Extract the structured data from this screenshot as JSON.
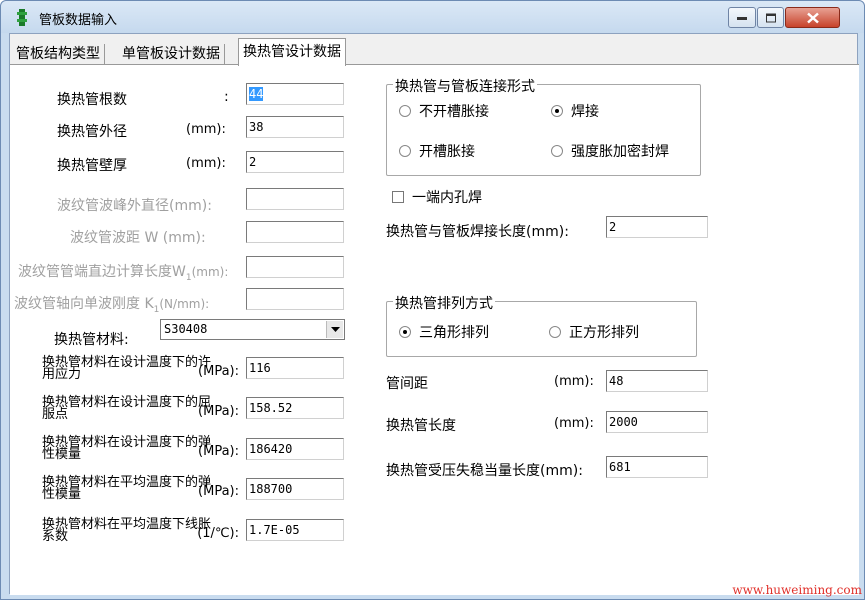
{
  "window": {
    "title": "管板数据输入"
  },
  "tabs": [
    {
      "label": "管板结构类型"
    },
    {
      "label": "单管板设计数据"
    },
    {
      "label": "换热管设计数据"
    }
  ],
  "left": {
    "tube_count": {
      "label": "换热管根数",
      "colon": ":",
      "value": "44"
    },
    "tube_od": {
      "label": "换热管外径",
      "unit": "(mm):",
      "value": "38"
    },
    "tube_thk": {
      "label": "换热管壁厚",
      "unit": "(mm):",
      "value": "2"
    },
    "bellow_od": {
      "label": "波纹管波峰外直径(mm):",
      "value": ""
    },
    "bellow_pitch": {
      "label": "波纹管波距  W (mm):",
      "value": ""
    },
    "bellow_end": {
      "label": "波纹管管端直边计算长度W",
      "sub": "1",
      "unit": "(mm):",
      "value": ""
    },
    "bellow_stiff": {
      "label": "波纹管轴向单波刚度 K",
      "sub": "1",
      "unit": "(N/mm):",
      "value": ""
    },
    "material": {
      "label": "换热管材料:",
      "value": "S30408"
    },
    "allow_stress": {
      "line1": "换热管材料在设计温度下的许",
      "line2": "用应力",
      "unit": "(MPa):",
      "value": "116"
    },
    "yield": {
      "line1": "换热管材料在设计温度下的屈",
      "line2": "服点",
      "unit": "(MPa):",
      "value": "158.52"
    },
    "modulus_design": {
      "line1": "换热管材料在设计温度下的弹",
      "line2": "性模量",
      "unit": "(MPa):",
      "value": "186420"
    },
    "modulus_avg": {
      "line1": "换热管材料在平均温度下的弹",
      "line2": "性模量",
      "unit": "(MPa):",
      "value": "188700"
    },
    "expansion": {
      "line1": "换热管材料在平均温度下线胀",
      "line2": "系数",
      "unit": "(1/℃):",
      "value": "1.7E-05"
    }
  },
  "right": {
    "connection": {
      "title": "换热管与管板连接形式",
      "options": [
        {
          "label": "不开槽胀接",
          "selected": false
        },
        {
          "label": "焊接",
          "selected": true
        },
        {
          "label": "开槽胀接",
          "selected": false
        },
        {
          "label": "强度胀加密封焊",
          "selected": false
        }
      ]
    },
    "inner_hole_weld": {
      "label": "一端内孔焊",
      "checked": false
    },
    "weld_length": {
      "label": "换热管与管板焊接长度(mm):",
      "value": "2"
    },
    "arrangement": {
      "title": "换热管排列方式",
      "options": [
        {
          "label": "三角形排列",
          "selected": true
        },
        {
          "label": "正方形排列",
          "selected": false
        }
      ]
    },
    "pitch": {
      "label": "管间距",
      "unit": "(mm):",
      "value": "48"
    },
    "tube_length": {
      "label": "换热管长度",
      "unit": "(mm):",
      "value": "2000"
    },
    "buckling_length": {
      "label": "换热管受压失稳当量长度(mm):",
      "value": "681"
    }
  },
  "watermark": "www.huweiming.com",
  "colors": {
    "accent": "#3399ff",
    "watermark": "#e0302a",
    "frame": "#c9dcef"
  }
}
